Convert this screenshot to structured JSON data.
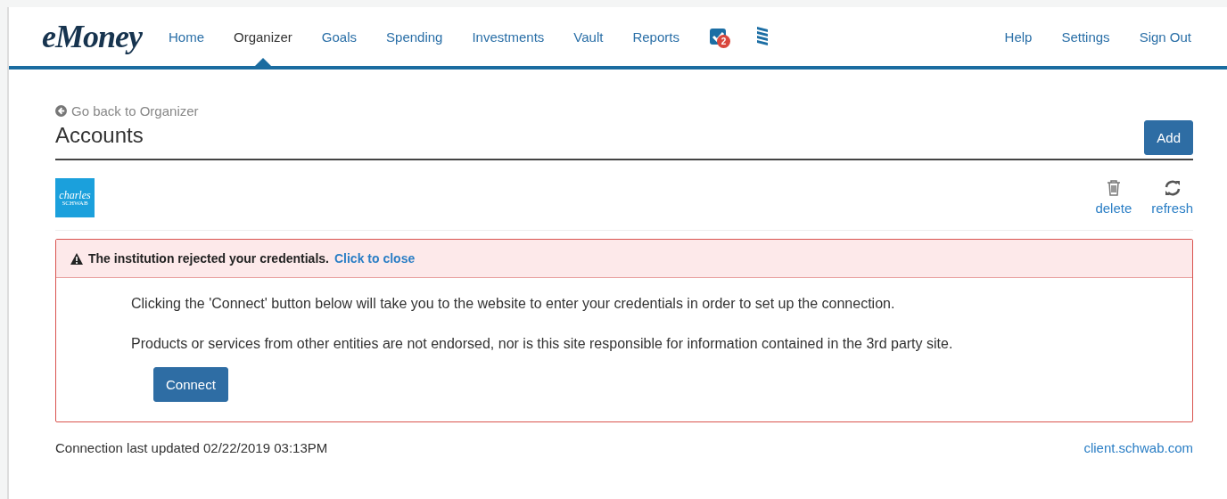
{
  "header": {
    "logo": "eMoney",
    "nav": [
      {
        "label": "Home",
        "selected": false
      },
      {
        "label": "Organizer",
        "selected": true
      },
      {
        "label": "Goals",
        "selected": false
      },
      {
        "label": "Spending",
        "selected": false
      },
      {
        "label": "Investments",
        "selected": false
      },
      {
        "label": "Vault",
        "selected": false
      },
      {
        "label": "Reports",
        "selected": false
      }
    ],
    "tasks_badge": "2",
    "right_links": [
      "Help",
      "Settings",
      "Sign Out"
    ]
  },
  "back_link": "Go back to Organizer",
  "title": "Accounts",
  "add_button": "Add",
  "institution": {
    "logo_lines": [
      "charles",
      "SCHWAB"
    ],
    "actions": [
      {
        "kind": "delete",
        "label": "delete"
      },
      {
        "kind": "refresh",
        "label": "refresh"
      }
    ]
  },
  "alert": {
    "message": "The institution rejected your credentials.",
    "close_link": "Click to close",
    "paragraphs": [
      "Clicking the 'Connect' button below will take you to the website to enter your credentials in order to set up the connection.",
      "Products or services from other entities are not endorsed, nor is this site responsible for information contained in the 3rd party site."
    ],
    "button": "Connect"
  },
  "footer": {
    "updated": "Connection last updated 02/22/2019 03:13PM",
    "site_link": "client.schwab.com"
  }
}
